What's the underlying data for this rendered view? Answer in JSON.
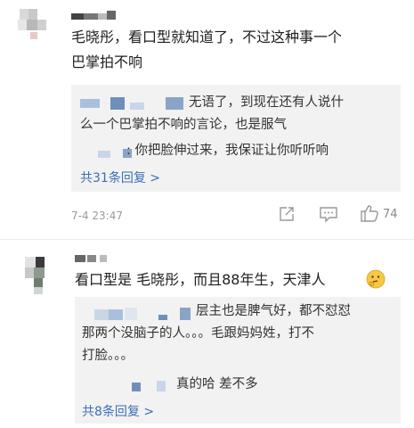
{
  "comments": [
    {
      "text": "毛晓彤，看口型就知道了，不过这种事一个巴掌拍不响",
      "text_line1": "毛晓彤，看口型就知道了，不过这种事一个",
      "text_line2": "巴掌拍不响",
      "replies": [
        {
          "line1": "无语了，到现在还有人说什",
          "line2": "么一个巴掌拍不响的言论，也是服气"
        },
        {
          "line1": ": 你把脸伸过来，我保证让你听听响"
        }
      ],
      "expand_label": "共31条回复 >",
      "timestamp": "7-4 23:47",
      "like_count": "74",
      "actions": [
        "share-icon",
        "comment-icon",
        "like-icon"
      ]
    },
    {
      "text_part1": "看口型是 毛晓彤，而且88年生，天津人",
      "emoji": "thinking-face-emoji",
      "replies": [
        {
          "line1": "层主也是脾气好，都不怼怼",
          "line2": "那两个没脑子的人。。。毛跟妈妈姓，打不",
          "line3": "打脸。。。"
        },
        {
          "line1": "真的哈 差不多"
        }
      ],
      "expand_label": "共8条回复 >"
    }
  ],
  "colors": {
    "link": "#3a6fb5",
    "reply_bg": "#f2f2f2",
    "meta": "#9a9a9a",
    "emoji": "#f7c843"
  }
}
